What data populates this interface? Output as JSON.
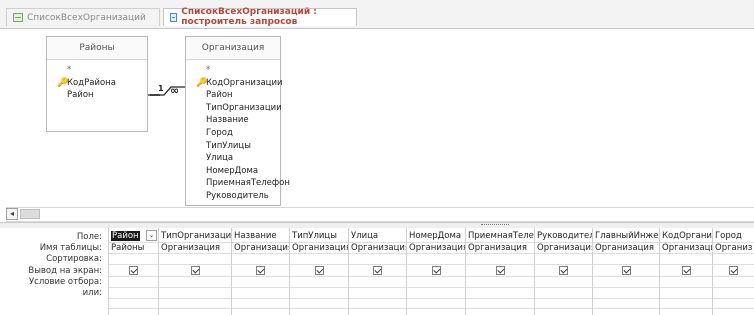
{
  "tabs": [
    {
      "label": "СписокВсехОрганизаций",
      "icon": "table-icon",
      "active": false
    },
    {
      "label": "СписокВсехОрганизаций : построитель запросов",
      "icon": "query-icon",
      "active": true
    }
  ],
  "tables": [
    {
      "name": "Районы",
      "fields": [
        {
          "label": "*",
          "key": false
        },
        {
          "label": "КодРайона",
          "key": true
        },
        {
          "label": "Район",
          "key": false
        }
      ]
    },
    {
      "name": "Организация",
      "fields": [
        {
          "label": "*",
          "key": false
        },
        {
          "label": "КодОрганизации",
          "key": true
        },
        {
          "label": "Район",
          "key": false
        },
        {
          "label": "ТипОрганизации",
          "key": false
        },
        {
          "label": "Название",
          "key": false
        },
        {
          "label": "Город",
          "key": false
        },
        {
          "label": "ТипУлицы",
          "key": false
        },
        {
          "label": "Улица",
          "key": false
        },
        {
          "label": "НомерДома",
          "key": false
        },
        {
          "label": "ПриемнаяТелефон",
          "key": false
        },
        {
          "label": "Руководитель",
          "key": false
        }
      ]
    }
  ],
  "relationship": {
    "one": "1",
    "many": "∞"
  },
  "grid": {
    "row_labels": [
      "Поле:",
      "Имя таблицы:",
      "Сортировка:",
      "Вывод на экран:",
      "Условие отбора:",
      "или:"
    ],
    "columns": [
      {
        "field": "Район",
        "table": "Районы",
        "show": true,
        "selected": true
      },
      {
        "field": "ТипОрганизации",
        "table": "Организация",
        "show": true
      },
      {
        "field": "Название",
        "table": "Организация",
        "show": true
      },
      {
        "field": "ТипУлицы",
        "table": "Организация",
        "show": true
      },
      {
        "field": "Улица",
        "table": "Организация",
        "show": true
      },
      {
        "field": "НомерДома",
        "table": "Организация",
        "show": true
      },
      {
        "field": "ПриемнаяТелефо",
        "table": "Организация",
        "show": true
      },
      {
        "field": "Руководитель",
        "table": "Организация",
        "show": true
      },
      {
        "field": "ГлавныйИнжен",
        "table": "Организация",
        "show": true
      },
      {
        "field": "КодОрганиза",
        "table": "Организация",
        "show": true
      },
      {
        "field": "Город",
        "table": "Организ",
        "show": true
      }
    ]
  }
}
